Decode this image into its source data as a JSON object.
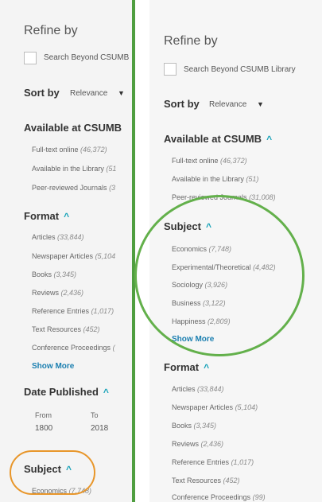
{
  "left": {
    "refine_title": "Refine by",
    "search_beyond_label": "Search Beyond CSUMB",
    "sort_label": "Sort by",
    "sort_value": "Relevance",
    "available_heading": "Available at CSUMB",
    "available_items": [
      {
        "label": "Full-text online",
        "count": "(46,372)"
      },
      {
        "label": "Available in the Library",
        "count": "(51"
      },
      {
        "label": "Peer-reviewed Journals",
        "count": "(3"
      }
    ],
    "format_heading": "Format",
    "format_items": [
      {
        "label": "Articles",
        "count": "(33,844)"
      },
      {
        "label": "Newspaper Articles",
        "count": "(5,104"
      },
      {
        "label": "Books",
        "count": "(3,345)"
      },
      {
        "label": "Reviews",
        "count": "(2,436)"
      },
      {
        "label": "Reference Entries",
        "count": "(1,017)"
      },
      {
        "label": "Text Resources",
        "count": "(452)"
      },
      {
        "label": "Conference Proceedings",
        "count": "("
      }
    ],
    "show_more": "Show More",
    "date_heading": "Date Published",
    "date_from_label": "From",
    "date_to_label": "To",
    "date_from_value": "1800",
    "date_to_value": "2018",
    "subject_heading": "Subject",
    "subject_first_item": {
      "label": "Economics",
      "count": "(7,748)"
    }
  },
  "right": {
    "refine_title": "Refine by",
    "search_beyond_label": "Search Beyond CSUMB Library",
    "sort_label": "Sort by",
    "sort_value": "Relevance",
    "available_heading": "Available at CSUMB",
    "available_items": [
      {
        "label": "Full-text online",
        "count": "(46,372)"
      },
      {
        "label": "Available in the Library",
        "count": "(51)"
      },
      {
        "label": "Peer-reviewed Journals",
        "count": "(31,008)"
      }
    ],
    "subject_heading": "Subject",
    "subject_items": [
      {
        "label": "Economics",
        "count": "(7,748)"
      },
      {
        "label": "Experimental/Theoretical",
        "count": "(4,482)"
      },
      {
        "label": "Sociology",
        "count": "(3,926)"
      },
      {
        "label": "Business",
        "count": "(3,122)"
      },
      {
        "label": "Happiness",
        "count": "(2,809)"
      }
    ],
    "show_more": "Show More",
    "format_heading": "Format",
    "format_items": [
      {
        "label": "Articles",
        "count": "(33,844)"
      },
      {
        "label": "Newspaper Articles",
        "count": "(5,104)"
      },
      {
        "label": "Books",
        "count": "(3,345)"
      },
      {
        "label": "Reviews",
        "count": "(2,436)"
      },
      {
        "label": "Reference Entries",
        "count": "(1,017)"
      },
      {
        "label": "Text Resources",
        "count": "(452)"
      },
      {
        "label": "Conference Proceedings",
        "count": "(99)"
      }
    ]
  },
  "glyphs": {
    "chevron_up": "^",
    "caret_down": "▼"
  },
  "colors": {
    "divider": "#4f9e3f",
    "green_highlight": "#63b04b",
    "orange_highlight": "#e8962a",
    "accent_link": "#1b7fb0",
    "chevron": "#17a2b8"
  }
}
